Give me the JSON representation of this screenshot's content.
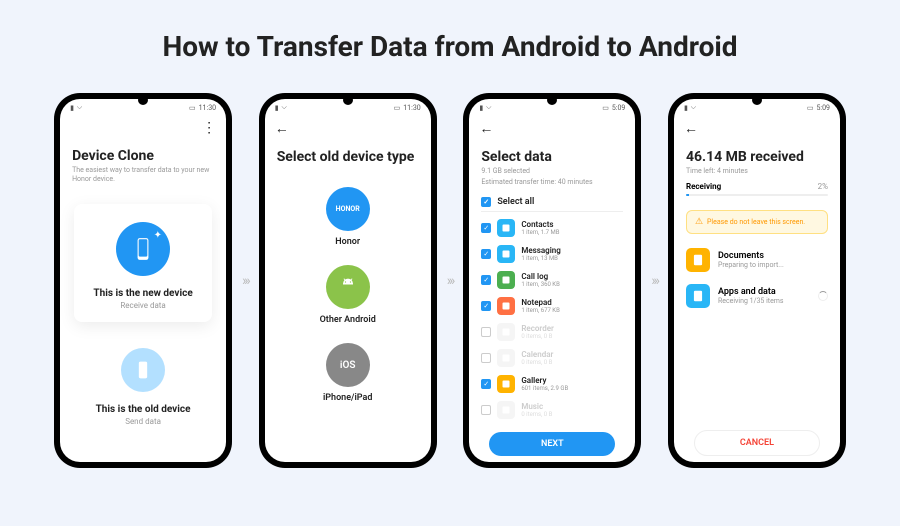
{
  "title": "How to Transfer Data from Android to Android",
  "arrow": "›››",
  "status": {
    "time1": "11:30",
    "time2": "5:09"
  },
  "s1": {
    "title": "Device Clone",
    "sub": "The easiest way to transfer data to your new Honor device.",
    "new": {
      "title": "This is the new device",
      "sub": "Receive data"
    },
    "old": {
      "title": "This is the old device",
      "sub": "Send data"
    }
  },
  "s2": {
    "title": "Select old device type",
    "items": [
      {
        "label": "Honor"
      },
      {
        "label": "Other Android"
      },
      {
        "label": "iPhone/iPad"
      }
    ]
  },
  "s3": {
    "title": "Select data",
    "sub1": "9.1 GB selected",
    "sub2": "Estimated transfer time: 40 minutes",
    "selectall": "Select all",
    "next": "NEXT",
    "rows": [
      {
        "name": "Contacts",
        "sub": "1 item, 1.7 MB",
        "checked": true,
        "color": "#29b6f6",
        "dim": false
      },
      {
        "name": "Messaging",
        "sub": "1 item, 13 MB",
        "checked": true,
        "color": "#29b6f6",
        "dim": false
      },
      {
        "name": "Call log",
        "sub": "1 item, 360 KB",
        "checked": true,
        "color": "#4caf50",
        "dim": false
      },
      {
        "name": "Notepad",
        "sub": "1 item, 677 KB",
        "checked": true,
        "color": "#ff7043",
        "dim": false
      },
      {
        "name": "Recorder",
        "sub": "0 items, 0 B",
        "checked": false,
        "color": "#eee",
        "dim": true
      },
      {
        "name": "Calendar",
        "sub": "0 items, 0 B",
        "checked": false,
        "color": "#eee",
        "dim": true
      },
      {
        "name": "Gallery",
        "sub": "601 items, 2.9 GB",
        "checked": true,
        "color": "#ffb300",
        "dim": false
      },
      {
        "name": "Music",
        "sub": "0 items, 0 B",
        "checked": false,
        "color": "#eee",
        "dim": true
      }
    ]
  },
  "s4": {
    "title": "46.14 MB received",
    "sub": "Time left: 4 minutes",
    "receiving": "Receiving",
    "pct": "2%",
    "warn": "Please do not leave this screen.",
    "cancel": "CANCEL",
    "items": [
      {
        "name": "Documents",
        "sub": "Preparing to import...",
        "color": "#ffb300"
      },
      {
        "name": "Apps and data",
        "sub": "Receiving 1/35 items",
        "color": "#29b6f6"
      }
    ]
  }
}
